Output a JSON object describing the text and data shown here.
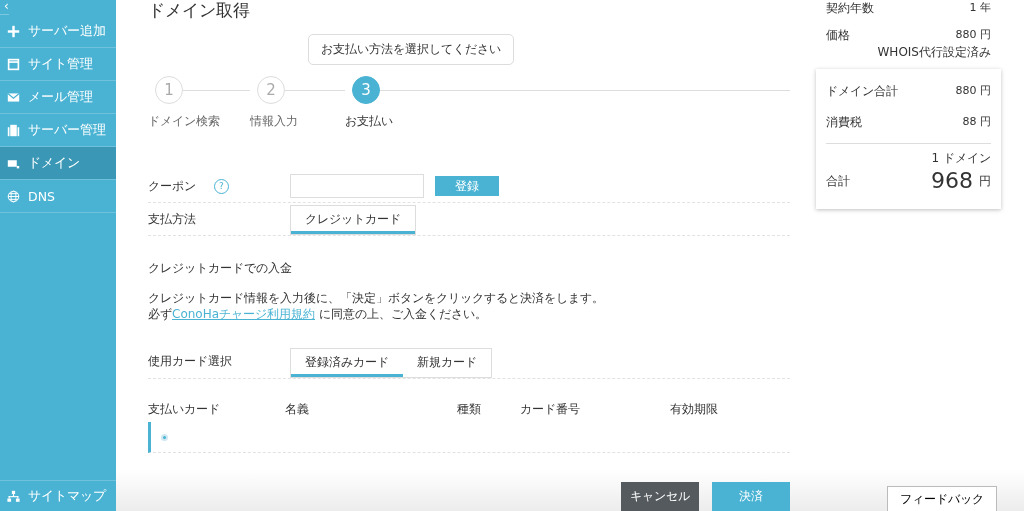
{
  "sidebar": {
    "back": "‹",
    "items": [
      {
        "kind": "plus",
        "label": "サーバー追加",
        "selected": false
      },
      {
        "kind": "window",
        "label": "サイト管理",
        "selected": false
      },
      {
        "kind": "mail",
        "label": "メール管理",
        "selected": false
      },
      {
        "kind": "server",
        "label": "サーバー管理",
        "selected": false
      },
      {
        "kind": "domain",
        "label": "ドメイン",
        "selected": true
      },
      {
        "kind": "globe",
        "label": "DNS",
        "selected": false
      }
    ],
    "footer": {
      "kind": "sitemap",
      "label": "サイトマップ"
    }
  },
  "page": {
    "title": "ドメイン取得",
    "tooltip": "お支払い方法を選択してください",
    "steps": [
      {
        "number": "1",
        "label": "ドメイン検索",
        "selected": false
      },
      {
        "number": "2",
        "label": "情報入力",
        "selected": false
      },
      {
        "number": "3",
        "label": "お支払い",
        "selected": true
      }
    ],
    "coupon": {
      "label": "クーポン",
      "help": "?",
      "button": "登録"
    },
    "payment_method": {
      "label": "支払方法",
      "tabs": [
        {
          "label": "クレジットカード",
          "selected": true
        }
      ]
    },
    "section_title": "クレジットカードでの入金",
    "notice": [
      "クレジットカード情報を入力後に、「決定」ボタンをクリックすると決済をします。"
    ],
    "notice_prefix": "必ず",
    "notice_link": "ConoHaチャージ利用規約",
    "notice_suffix": "に同意の上、ご入金ください。",
    "card_select": {
      "label": "使用カード選択",
      "tabs": [
        {
          "label": "登録済みカード",
          "selected": true
        },
        {
          "label": "新規カード",
          "selected": false
        }
      ]
    },
    "card_table": {
      "columns": [
        "支払いカード",
        "名義",
        "種類",
        "カード番号",
        "有効期限"
      ],
      "rows": [
        {
          "selected": true
        }
      ]
    },
    "buttons": {
      "cancel": "キャンセル",
      "submit": "決済"
    }
  },
  "summary": {
    "top_rows": [
      {
        "label": "契約年数",
        "value": "1 年"
      },
      {
        "label": "価格",
        "value": "880 円",
        "note": "WHOIS代行設定済み"
      }
    ],
    "rows": [
      {
        "label": "ドメイン合計",
        "value": "880 円"
      },
      {
        "label": "消費税",
        "value": "88 円"
      }
    ],
    "total": {
      "count": "1 ドメイン",
      "label": "合計",
      "amount": "968",
      "unit": "円"
    }
  },
  "feedback": "フィードバック"
}
